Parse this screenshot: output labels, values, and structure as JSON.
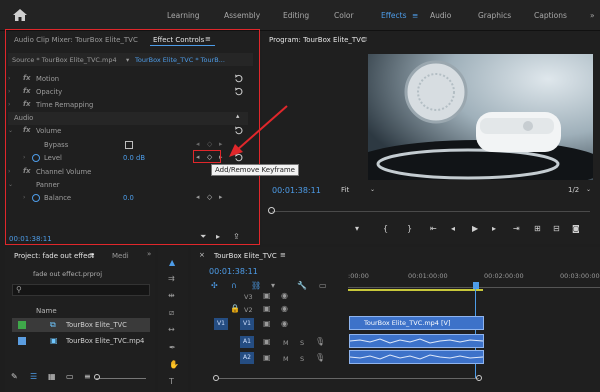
{
  "workspaces": [
    "Learning",
    "Assembly",
    "Editing",
    "Color",
    "Effects",
    "Audio",
    "Graphics",
    "Captions"
  ],
  "active_workspace": "Effects",
  "effect_panel": {
    "tabs": [
      "Audio Clip Mixer: TourBox Elite_TVC",
      "Effect Controls"
    ],
    "source_label": "Source * TourBox Elite_TVC.mp4",
    "sequence_label": "TourBox Elite_TVC * TourB...",
    "motion": "Motion",
    "opacity": "Opacity",
    "time_remapping": "Time Remapping",
    "audio_header": "Audio",
    "volume": "Volume",
    "bypass": "Bypass",
    "level": "Level",
    "level_value": "0.0",
    "level_unit": "dB",
    "channel_volume": "Channel Volume",
    "panner": "Panner",
    "balance": "Balance",
    "balance_value": "0.0",
    "keyframe_value": "0",
    "timecode": "00:01:38:11"
  },
  "tooltip": "Add/Remove Keyframe",
  "program_monitor": {
    "title": "Program: TourBox Elite_TVC",
    "timecode": "00:01:38:11",
    "fit": "Fit",
    "ratio": "1/2"
  },
  "project_panel": {
    "tab": "Project: fade out effect",
    "media_tab": "Medi",
    "file": "fade out effect.prproj",
    "col_name": "Name",
    "items": [
      "TourBox Elite_TVC",
      "TourBox Elite_TVC.mp4"
    ]
  },
  "timeline": {
    "title": "TourBox Elite_TVC",
    "timecode": "00:01:38:11",
    "ruler": [
      ":00:00",
      "00:01:00:00",
      "00:02:00:00",
      "00:03:00:00"
    ],
    "tracks": [
      "V3",
      "V2",
      "V1",
      "A1",
      "A2"
    ],
    "track_letters": [
      "M",
      "S",
      "M",
      "S"
    ],
    "clip_video": "TourBox Elite_TVC.mp4 [V]"
  },
  "colors": {
    "accent": "#4d9ce8",
    "highlight": "#e0272b",
    "clip": "#3d72c9"
  }
}
